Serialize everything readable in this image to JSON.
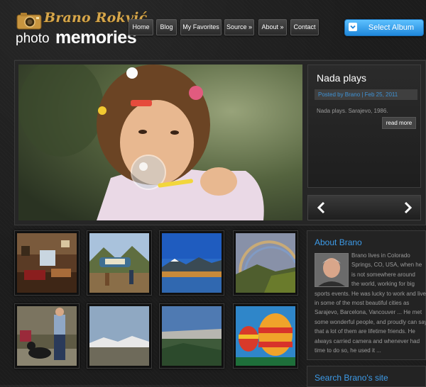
{
  "logo": {
    "line1": "Brano Rokvić",
    "photo": "photo",
    "memories": "memories",
    "icon": "camera-icon"
  },
  "nav": {
    "items": [
      "Home",
      "Blog",
      "My Favorites",
      "Source »",
      "About »",
      "Contact"
    ]
  },
  "album_button": {
    "label": "Select Album",
    "icon": "chevron-down-icon"
  },
  "featured": {
    "title": "Nada plays",
    "meta": "Posted by Brano | Feb 25, 2011",
    "excerpt": "Nada plays. Sarajevo, 1986.",
    "read_more": "read more",
    "prev_icon": "chevron-left-icon",
    "next_icon": "chevron-right-icon"
  },
  "about": {
    "title": "About Brano",
    "lines": [
      "Brano lives in Colorado",
      "Springs, CO, USA, when he",
      "is not somewhere around",
      "the world, working for big",
      "sports events. He was lucky to work and live",
      "in some of the most beautiful cities as",
      "Sarajevo, Barcelona, Vancouver ... He met",
      "some wonderful people, and proudly can say",
      "that a lot of them are lifetime friends. He",
      "always carried camera and whenever had",
      "time to do so, he used it ..."
    ]
  },
  "search": {
    "title": "Search Brano's site"
  },
  "thumbnails": [
    {
      "name": "thumb-living-room"
    },
    {
      "name": "thumb-alma-sign"
    },
    {
      "name": "thumb-mountain-lake"
    },
    {
      "name": "thumb-rainbow"
    },
    {
      "name": "thumb-man-with-dog"
    },
    {
      "name": "thumb-snow-mountains"
    },
    {
      "name": "thumb-valley-view"
    },
    {
      "name": "thumb-hot-air-balloons"
    }
  ],
  "colors": {
    "accent_blue": "#3d9be8",
    "meta_blue": "#3f93d6",
    "logo_gold": "#d7a74b",
    "background": "#1c1c1c"
  }
}
